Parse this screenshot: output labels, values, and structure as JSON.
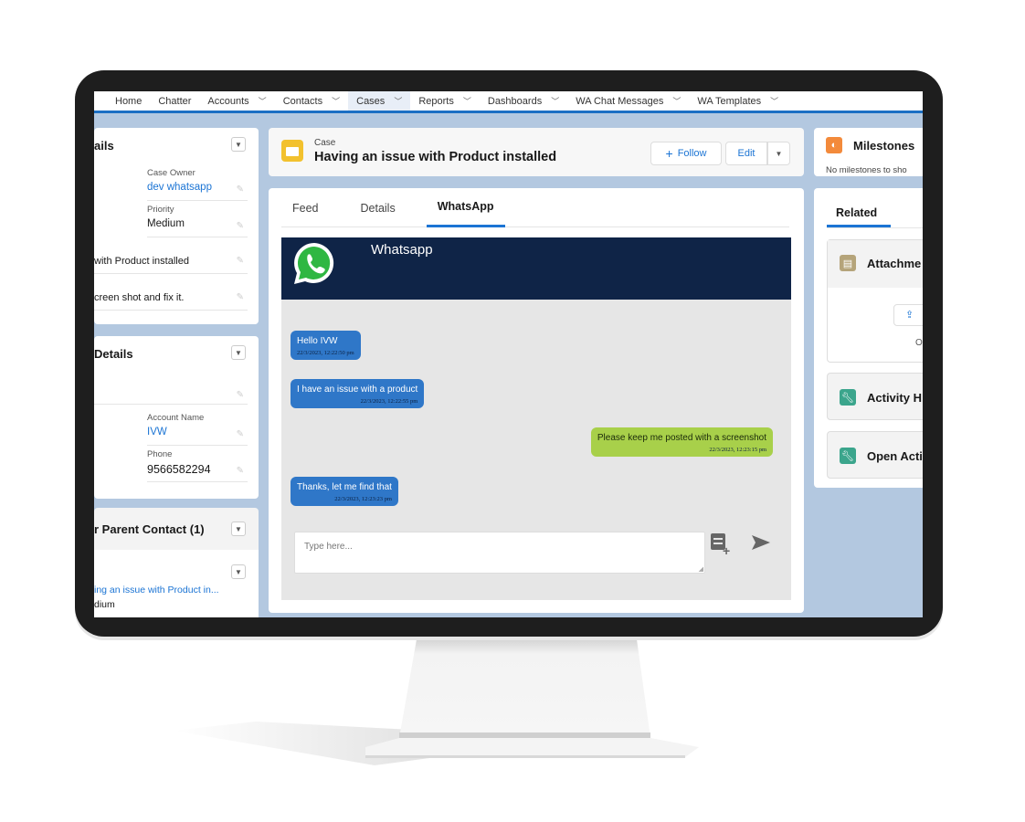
{
  "nav": {
    "items": [
      {
        "label": "Home",
        "dropdown": false
      },
      {
        "label": "Chatter",
        "dropdown": false
      },
      {
        "label": "Accounts",
        "dropdown": true
      },
      {
        "label": "Contacts",
        "dropdown": true
      },
      {
        "label": "Cases",
        "dropdown": true,
        "active": true
      },
      {
        "label": "Reports",
        "dropdown": true
      },
      {
        "label": "Dashboards",
        "dropdown": true
      },
      {
        "label": "WA Chat Messages",
        "dropdown": true
      },
      {
        "label": "WA Templates",
        "dropdown": true
      }
    ]
  },
  "left": {
    "details_card": {
      "title": "ails",
      "case_owner_label": "Case Owner",
      "case_owner_value": "dev whatsapp",
      "priority_label": "Priority",
      "priority_value": "Medium",
      "subject_value": "with Product installed",
      "description_value": "creen shot and fix it."
    },
    "contact_card": {
      "title": "Details",
      "account_name_label": "Account Name",
      "account_name_value": "IVW",
      "phone_label": "Phone",
      "phone_value": "9566582294"
    },
    "parent_card": {
      "title": "r Parent Contact (1)",
      "item_link": "ing an issue with Product in...",
      "item_priority": "dium"
    }
  },
  "case_header": {
    "object_label": "Case",
    "title": "Having an issue with Product installed",
    "follow_label": "Follow",
    "edit_label": "Edit"
  },
  "tabs": [
    {
      "label": "Feed"
    },
    {
      "label": "Details"
    },
    {
      "label": "WhatsApp",
      "active": true
    }
  ],
  "whatsapp": {
    "header_title": "Whatsapp",
    "header_color": "#0f2447",
    "incoming_color": "#2f77c8",
    "outgoing_color": "#a8d04a",
    "messages": [
      {
        "text": "Hello IVW",
        "time": "22/3/2023, 12:22:50 pm",
        "direction": "incoming"
      },
      {
        "text": "I have an issue with a product",
        "time": "22/3/2023, 12:22:55 pm",
        "direction": "incoming"
      },
      {
        "text": "Please keep me posted with a screenshot",
        "time": "22/3/2023, 12:23:15 pm",
        "direction": "outgoing"
      },
      {
        "text": "Thanks, let me find that",
        "time": "22/3/2023, 12:23:23 pm",
        "direction": "incoming"
      }
    ],
    "input_placeholder": "Type here..."
  },
  "right": {
    "milestones_title": "Milestones",
    "milestones_empty": "No milestones to sho",
    "related_tab": "Related",
    "attachments_title": "Attachme",
    "upload_caption": "O",
    "activity_history_title": "Activity H",
    "open_activities_title": "Open Acti"
  }
}
